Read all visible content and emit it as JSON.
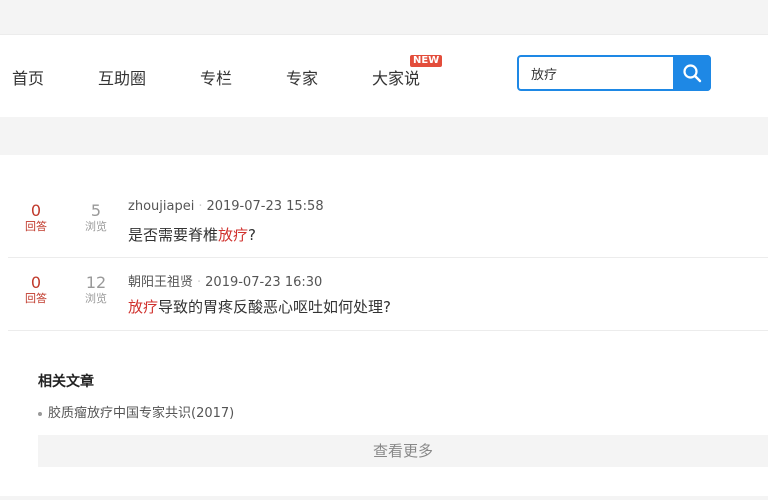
{
  "nav": {
    "items": [
      {
        "label": "首页"
      },
      {
        "label": "互助圈"
      },
      {
        "label": "专栏"
      },
      {
        "label": "专家"
      },
      {
        "label": "大家说"
      }
    ],
    "new_badge": "NEW"
  },
  "search": {
    "value": "放疗",
    "icon": "search-icon",
    "accent_color": "#1e88e5"
  },
  "questions": [
    {
      "answers": "0",
      "answers_label": "回答",
      "views": "5",
      "views_label": "浏览",
      "author": "zhoujiapei",
      "time": "2019-07-23 15:58",
      "title_pre": "是否需要脊椎",
      "title_hl": "放疗",
      "title_post": "?"
    },
    {
      "answers": "0",
      "answers_label": "回答",
      "views": "12",
      "views_label": "浏览",
      "author": "朝阳王祖贤",
      "time": "2019-07-23 16:30",
      "title_pre": "",
      "title_hl": "放疗",
      "title_post": "导致的胃疼反酸恶心呕吐如何处理?"
    }
  ],
  "related": {
    "title": "相关文章",
    "items": [
      {
        "label": "胶质瘤放疗中国专家共识(2017)"
      }
    ],
    "more_label": "查看更多"
  },
  "colors": {
    "highlight": "#d0312d",
    "badge": "#e34d3b"
  }
}
